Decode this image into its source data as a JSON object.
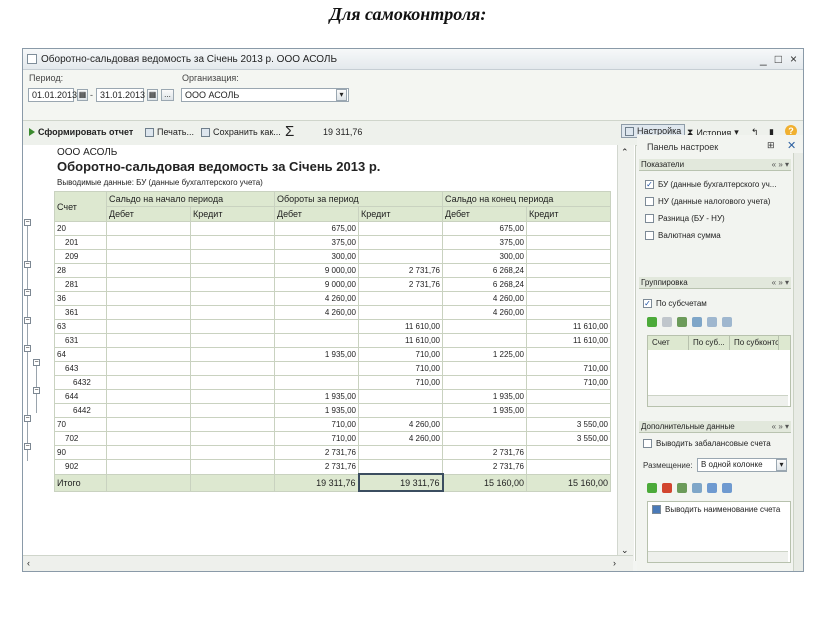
{
  "heading": "Для самоконтроля:",
  "window": {
    "title": "Оборотно-сальдовая ведомость за Січень 2013 р. ООО АСОЛЬ",
    "controls": [
      "_",
      "□",
      "×"
    ]
  },
  "params": {
    "period_label": "Период:",
    "date_from": "01.01.2013",
    "date_sep": "-",
    "date_to": "31.01.2013",
    "ellipsis": "...",
    "org_label": "Организация:",
    "org_value": "ООО АСОЛЬ"
  },
  "toolbar": {
    "generate": "Сформировать отчет",
    "print": "Печать...",
    "save": "Сохранить как...",
    "sigma": "Σ",
    "sum": "19 311,76",
    "settings": "Настройка",
    "history": "История"
  },
  "report": {
    "org": "ООО АСОЛЬ",
    "title": "Оборотно-сальдовая ведомость за Січень 2013 р.",
    "output": "Выводимые данные:  БУ (данные бухгалтерского учета)",
    "headers": {
      "account": "Счет",
      "opening": "Сальдо на начало периода",
      "turnover": "Обороты за период",
      "closing": "Сальдо на конец периода",
      "debit": "Дебет",
      "credit": "Кредит"
    },
    "rows": [
      {
        "acc": "20",
        "level": 0,
        "ob_d": "675,00",
        "ob_k": "",
        "cl_d": "675,00",
        "cl_k": ""
      },
      {
        "acc": "201",
        "level": 1,
        "ob_d": "375,00",
        "ob_k": "",
        "cl_d": "375,00",
        "cl_k": ""
      },
      {
        "acc": "209",
        "level": 1,
        "ob_d": "300,00",
        "ob_k": "",
        "cl_d": "300,00",
        "cl_k": ""
      },
      {
        "acc": "28",
        "level": 0,
        "ob_d": "9 000,00",
        "ob_k": "2 731,76",
        "cl_d": "6 268,24",
        "cl_k": ""
      },
      {
        "acc": "281",
        "level": 1,
        "ob_d": "9 000,00",
        "ob_k": "2 731,76",
        "cl_d": "6 268,24",
        "cl_k": ""
      },
      {
        "acc": "36",
        "level": 0,
        "ob_d": "4 260,00",
        "ob_k": "",
        "cl_d": "4 260,00",
        "cl_k": ""
      },
      {
        "acc": "361",
        "level": 1,
        "ob_d": "4 260,00",
        "ob_k": "",
        "cl_d": "4 260,00",
        "cl_k": ""
      },
      {
        "acc": "63",
        "level": 0,
        "ob_d": "",
        "ob_k": "11 610,00",
        "cl_d": "",
        "cl_k": "11 610,00"
      },
      {
        "acc": "631",
        "level": 1,
        "ob_d": "",
        "ob_k": "11 610,00",
        "cl_d": "",
        "cl_k": "11 610,00"
      },
      {
        "acc": "64",
        "level": 0,
        "ob_d": "1 935,00",
        "ob_k": "710,00",
        "cl_d": "1 225,00",
        "cl_k": ""
      },
      {
        "acc": "643",
        "level": 1,
        "ob_d": "",
        "ob_k": "710,00",
        "cl_d": "",
        "cl_k": "710,00"
      },
      {
        "acc": "6432",
        "level": 2,
        "ob_d": "",
        "ob_k": "710,00",
        "cl_d": "",
        "cl_k": "710,00"
      },
      {
        "acc": "644",
        "level": 1,
        "ob_d": "1 935,00",
        "ob_k": "",
        "cl_d": "1 935,00",
        "cl_k": ""
      },
      {
        "acc": "6442",
        "level": 2,
        "ob_d": "1 935,00",
        "ob_k": "",
        "cl_d": "1 935,00",
        "cl_k": ""
      },
      {
        "acc": "70",
        "level": 0,
        "ob_d": "710,00",
        "ob_k": "4 260,00",
        "cl_d": "",
        "cl_k": "3 550,00"
      },
      {
        "acc": "702",
        "level": 1,
        "ob_d": "710,00",
        "ob_k": "4 260,00",
        "cl_d": "",
        "cl_k": "3 550,00"
      },
      {
        "acc": "90",
        "level": 0,
        "ob_d": "2 731,76",
        "ob_k": "",
        "cl_d": "2 731,76",
        "cl_k": ""
      },
      {
        "acc": "902",
        "level": 1,
        "ob_d": "2 731,76",
        "ob_k": "",
        "cl_d": "2 731,76",
        "cl_k": ""
      }
    ],
    "total": {
      "label": "Итого",
      "ob_d": "19 311,76",
      "ob_k": "19 311,76",
      "cl_d": "15 160,00",
      "cl_k": "15 160,00"
    }
  },
  "settings_panel": {
    "title": "Панель настроек",
    "indicators_label": "Показатели",
    "indicators": [
      {
        "label": "БУ (данные бухгалтерского уч...",
        "checked": true
      },
      {
        "label": "НУ (данные налогового учета)",
        "checked": false
      },
      {
        "label": "Разница (БУ - НУ)",
        "checked": false
      },
      {
        "label": "Валютная сумма",
        "checked": false
      }
    ],
    "grouping_label": "Группировка",
    "by_subaccounts": "По субсчетам",
    "group_cols": [
      "Счет",
      "По суб...",
      "По субконто"
    ],
    "extra_label": "Дополнительные данные",
    "offbalance": "Выводить забалансовые счета",
    "placement_label": "Размещение:",
    "placement_value": "В одной колонке",
    "show_name": "Выводить наименование счета",
    "section_ctl": "« » ▾"
  }
}
